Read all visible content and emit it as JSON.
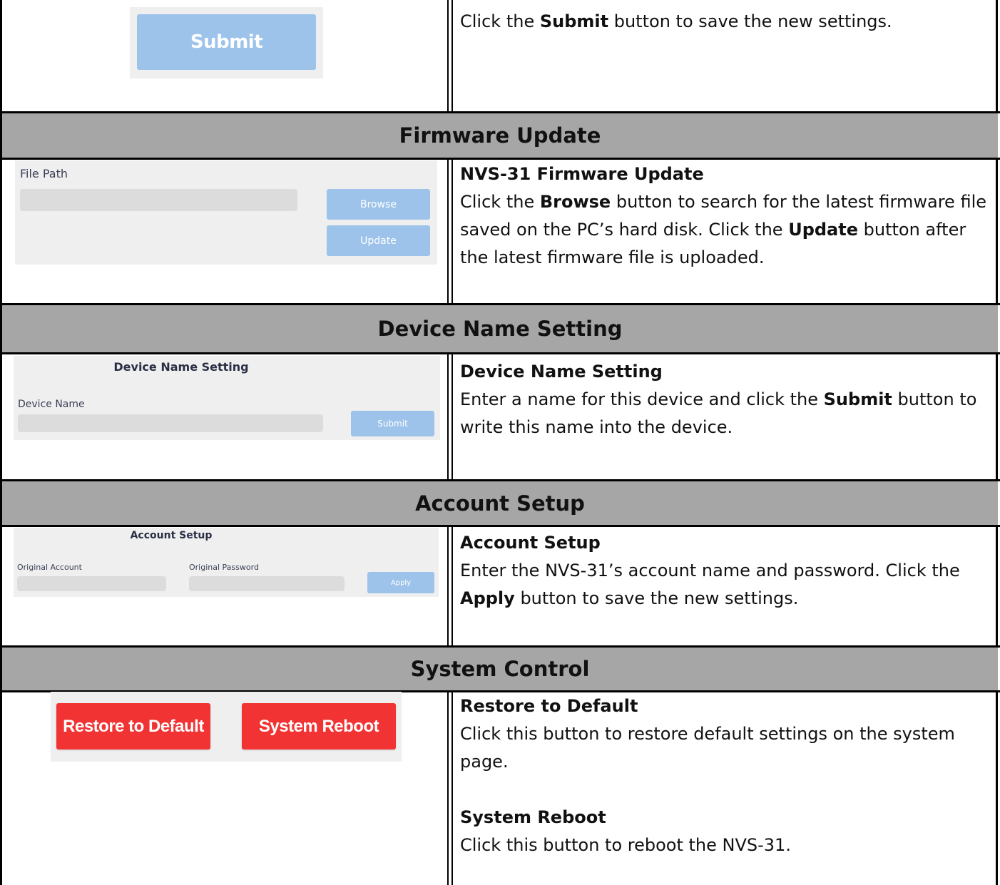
{
  "row_submit": {
    "button_label": "Submit",
    "desc_pre": "Click the ",
    "desc_bold": "Submit",
    "desc_post": " button to save the new settings."
  },
  "firmware": {
    "section_title": "Firmware Update",
    "panel": {
      "file_path_label": "File Path",
      "browse_label": "Browse",
      "update_label": "Update"
    },
    "desc_heading": "NVS-31 Firmware Update",
    "desc_1": "Click the ",
    "desc_bold_1": "Browse",
    "desc_2": " button to search for the latest firmware file saved on the PC’s hard disk. Click the ",
    "desc_bold_2": "Update",
    "desc_3": " button after the latest firmware file is uploaded."
  },
  "device_name": {
    "section_title": "Device Name Setting",
    "panel": {
      "title": "Device Name Setting",
      "field_label": "Device Name",
      "submit_label": "Submit"
    },
    "desc_heading": "Device Name Setting",
    "desc_1": "Enter a name for this device and click the ",
    "desc_bold_1": "Submit",
    "desc_2": " button to write this name into the device."
  },
  "account": {
    "section_title": "Account Setup",
    "panel": {
      "title": "Account Setup",
      "account_label": "Original Account",
      "password_label": "Original Password",
      "apply_label": "Apply"
    },
    "desc_heading": "Account Setup",
    "desc_1": "Enter the NVS-31’s account name and password. Click the ",
    "desc_bold_1": "Apply",
    "desc_2": " button to save the new settings."
  },
  "system": {
    "section_title": "System Control",
    "panel": {
      "restore_label": "Restore to Default",
      "reboot_label": "System Reboot"
    },
    "restore_heading": "Restore to Default",
    "restore_desc": "Click this button to restore default settings on the system page.",
    "reboot_heading": "System Reboot",
    "reboot_desc": "Click this button to reboot the NVS-31."
  },
  "colors": {
    "header_bg": "#a6a6a6",
    "panel_bg": "#efefef",
    "button_blue": "#9dc3ea",
    "button_red": "#f23333"
  }
}
